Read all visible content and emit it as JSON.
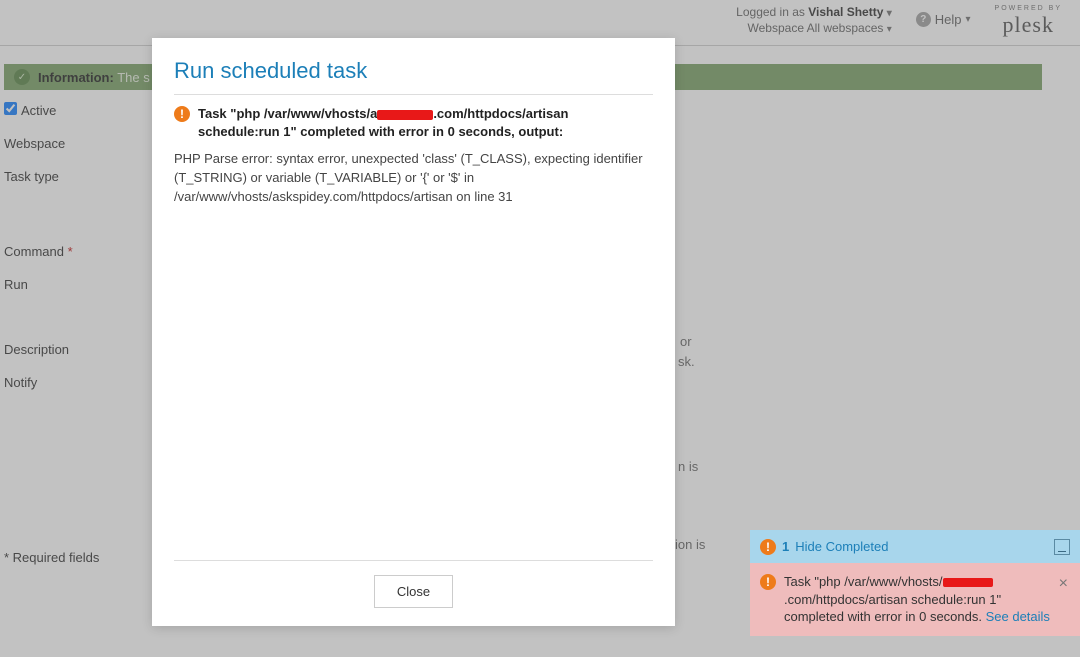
{
  "header": {
    "logged_in_as_label": "Logged in as",
    "user_name": "Vishal Shetty",
    "webspace_label": "Webspace",
    "webspace_value": "All webspaces",
    "help_label": "Help",
    "powered_by": "POWERED BY",
    "brand": "plesk"
  },
  "page": {
    "info_label": "Information:",
    "info_text": "The s",
    "active_label": "Active",
    "webspace_label": "Webspace",
    "task_type_label": "Task type",
    "command_label": "Command",
    "run_label": "Run",
    "description_label": "Description",
    "notify_label": "Notify",
    "required_fields_label": "* Required fields",
    "peek1": "or",
    "peek2": "sk.",
    "peek3": "n is",
    "peek4": "ion is"
  },
  "modal": {
    "title": "Run scheduled task",
    "error_prefix": "Task \"php /var/www/vhosts/a",
    "error_suffix": ".com/httpdocs/artisan schedule:run 1\" completed with error in 0 seconds, output:",
    "output": "PHP Parse error:  syntax error, unexpected 'class' (T_CLASS), expecting identifier (T_STRING) or variable (T_VARIABLE) or '{' or '$' in /var/www/vhosts/askspidey.com/httpdocs/artisan on line 31",
    "close_label": "Close"
  },
  "toast": {
    "count": "1",
    "hide_label": "Hide Completed",
    "msg_prefix": "Task \"php /var/www/vhosts/",
    "msg_suffix": ".com/httpdocs/artisan schedule:run 1\" completed with error in 0 seconds.",
    "see_details": "See details"
  }
}
